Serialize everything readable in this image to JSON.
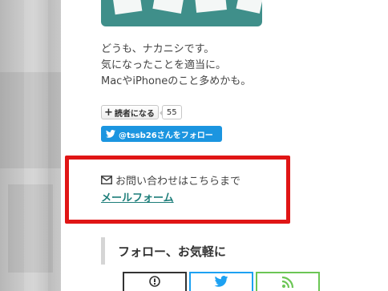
{
  "profile": {
    "bio_lines": [
      "どうも、ナカニシです。",
      "気になったことを適当に。",
      "MacやiPhoneのこと多めかも。"
    ]
  },
  "hatena": {
    "button_label": "読者になる",
    "plus": "+",
    "count": "55"
  },
  "twitter_follow": {
    "label": "@tssb26さんをフォロー"
  },
  "contact": {
    "text": "お問い合わせはこちらまで",
    "link_label": "メールフォーム"
  },
  "follow_section": {
    "heading": "フォロー、お気軽に",
    "buttons": [
      {
        "icon": "hatena-icon",
        "color": "#333333"
      },
      {
        "icon": "twitter-bird-icon",
        "color": "#1da1f2"
      },
      {
        "icon": "rss-icon",
        "color": "#6cc655"
      }
    ]
  },
  "colors": {
    "highlight": "#e01515",
    "teal": "#3f8f8a",
    "link": "#1e7e7a",
    "twitter": "#1b95e0"
  }
}
